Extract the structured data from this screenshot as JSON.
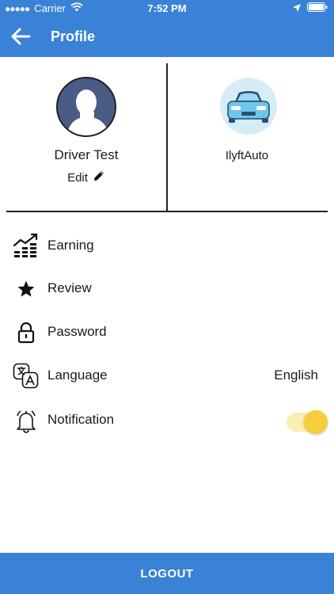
{
  "status_bar": {
    "carrier": "Carrier",
    "time": "7:52 PM"
  },
  "header": {
    "title": "Profile",
    "back_icon": "arrow-left-icon"
  },
  "driver": {
    "name": "Driver Test",
    "edit_label": "Edit"
  },
  "car": {
    "name": "IlyftAuto"
  },
  "menu": {
    "items": [
      {
        "label": "Earning",
        "icon": "earning-chart-icon"
      },
      {
        "label": "Review",
        "icon": "star-icon"
      },
      {
        "label": "Password",
        "icon": "lock-icon"
      },
      {
        "label": "Language",
        "icon": "translate-icon",
        "value": "English"
      },
      {
        "label": "Notification",
        "icon": "bell-icon",
        "toggle_on": true
      }
    ]
  },
  "footer": {
    "logout_label": "LOGOUT"
  },
  "colors": {
    "primary": "#3a82d6",
    "toggle_knob": "#f5ce3e",
    "toggle_track": "#fbeeb3",
    "avatar_bg": "#4a5b85",
    "car_color": "#6ec6ee"
  }
}
